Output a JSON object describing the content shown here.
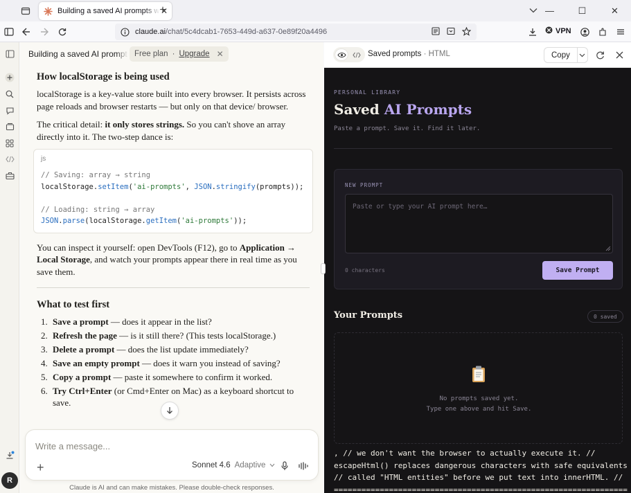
{
  "browser": {
    "tab_title": "Building a saved AI prompts web",
    "url_host": "claude.ai",
    "url_path": "/chat/5c4dcab1-7653-449d-a637-0e89f20a4496",
    "vpn_label": "VPN"
  },
  "chat": {
    "title": "Building a saved AI prompts w",
    "plan_label": "Free plan",
    "upgrade_label": "Upgrade",
    "heading_localstorage": "How localStorage is being used",
    "p1": "localStorage is a key-value store built into every browser. It persists across page reloads and browser restarts — but only on that device/ browser.",
    "p2_before": "The critical detail: ",
    "p2_bold": "it only stores strings.",
    "p2_after": " So you can't shove an array directly into it. The two-step dance is:",
    "code_lang": "js",
    "code": {
      "c1": "// Saving: array → string",
      "l1_obj": "localStorage",
      "l1_dot": ".",
      "l1_fn": "setItem",
      "l1_open": "(",
      "l1_str": "'ai-prompts'",
      "l1_mid": ", ",
      "l1_json": "JSON",
      "l1_dot2": ".",
      "l1_fn2": "stringify",
      "l1_end": "(prompts));",
      "c2": "// Loading: string → array",
      "l2_json": "JSON",
      "l2_dot": ".",
      "l2_fn": "parse",
      "l2_open": "(",
      "l2_obj": "localStorage",
      "l2_dot2": ".",
      "l2_fn2": "getItem",
      "l2_open2": "(",
      "l2_str": "'ai-prompts'",
      "l2_end": "));"
    },
    "p3_before": "You can inspect it yourself: open DevTools (F12), go to ",
    "p3_bold": "Application → Local Storage",
    "p3_after": ", and watch your prompts appear there in real time as you save them.",
    "heading_test": "What to test first",
    "tests": [
      {
        "n": "1.",
        "bold": "Save a prompt",
        "rest": " — does it appear in the list?"
      },
      {
        "n": "2.",
        "bold": "Refresh the page",
        "rest": " — is it still there? (This tests localStorage.)"
      },
      {
        "n": "3.",
        "bold": "Delete a prompt",
        "rest": " — does the list update immediately?"
      },
      {
        "n": "4.",
        "bold": "Save an empty prompt",
        "rest": " — does it warn you instead of saving?"
      },
      {
        "n": "5.",
        "bold": "Copy a prompt",
        "rest": " — paste it somewhere to confirm it worked."
      },
      {
        "n": "6.",
        "bold": "Try Ctrl+Enter",
        "rest": " (or Cmd+Enter on Mac) as a keyboard shortcut to save."
      }
    ],
    "composer_placeholder": "Write a message...",
    "model_name": "Sonnet 4.6",
    "model_mode": "Adaptive",
    "disclaimer": "Claude is AI and can make mistakes. Please double-check responses.",
    "avatar_initial": "R"
  },
  "artifact": {
    "title": "Saved prompts",
    "kind": "HTML",
    "copy_label": "Copy",
    "eyebrow": "PERSONAL LIBRARY",
    "app_title_plain": "Saved ",
    "app_title_accent": "AI Prompts",
    "app_subtitle": "Paste a prompt. Save it. Find it later.",
    "new_prompt_label": "NEW PROMPT",
    "textarea_placeholder": "Paste or type your AI prompt here…",
    "char_count": "0 characters",
    "save_button": "Save Prompt",
    "list_title": "Your Prompts",
    "saved_count": "0 saved",
    "empty_line1": "No prompts saved yet.",
    "empty_line2": "Type one above and hit Save.",
    "leaked_code": ", // we don't want the browser to actually execute it. //\nescapeHtml() replaces dangerous characters with safe equivalents\n// called \"HTML entities\" before we put text into innerHTML. //\n================================================================"
  },
  "colors": {
    "accent": "#b9a6ef",
    "button": "#c0aff2",
    "app_bg": "#151416"
  }
}
